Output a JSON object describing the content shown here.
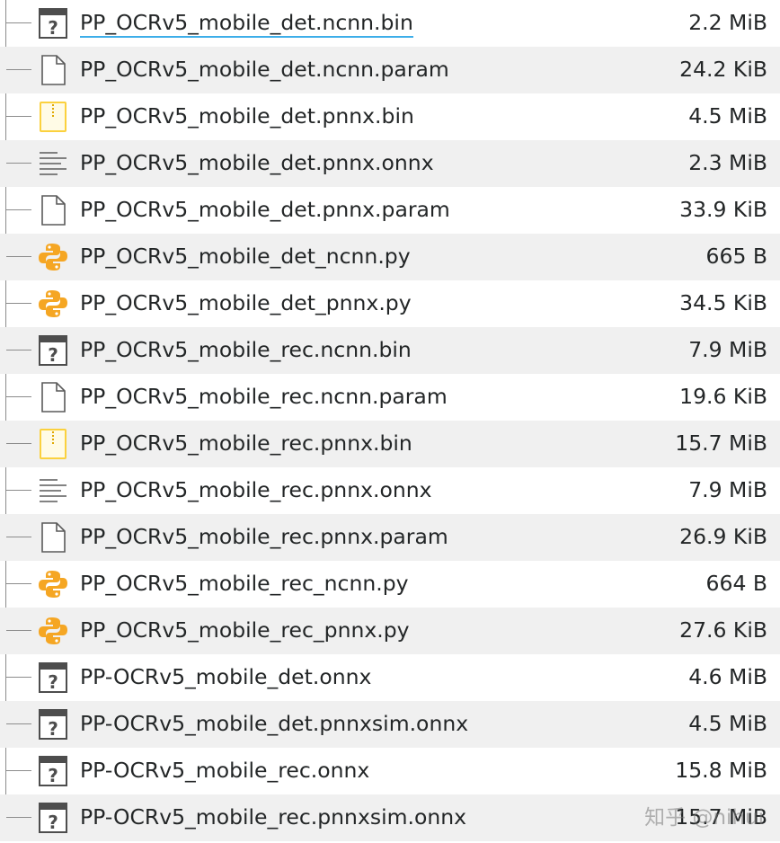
{
  "files": [
    {
      "name": "PP_OCRv5_mobile_det.ncnn.bin",
      "size": "2.2 MiB",
      "icon": "unknown-file-icon",
      "current": true
    },
    {
      "name": "PP_OCRv5_mobile_det.ncnn.param",
      "size": "24.2 KiB",
      "icon": "blank-file-icon"
    },
    {
      "name": "PP_OCRv5_mobile_det.pnnx.bin",
      "size": "4.5 MiB",
      "icon": "archive-file-icon"
    },
    {
      "name": "PP_OCRv5_mobile_det.pnnx.onnx",
      "size": "2.3 MiB",
      "icon": "text-file-icon"
    },
    {
      "name": "PP_OCRv5_mobile_det.pnnx.param",
      "size": "33.9 KiB",
      "icon": "blank-file-icon"
    },
    {
      "name": "PP_OCRv5_mobile_det_ncnn.py",
      "size": "665 B",
      "icon": "python-file-icon"
    },
    {
      "name": "PP_OCRv5_mobile_det_pnnx.py",
      "size": "34.5 KiB",
      "icon": "python-file-icon"
    },
    {
      "name": "PP_OCRv5_mobile_rec.ncnn.bin",
      "size": "7.9 MiB",
      "icon": "unknown-file-icon"
    },
    {
      "name": "PP_OCRv5_mobile_rec.ncnn.param",
      "size": "19.6 KiB",
      "icon": "blank-file-icon"
    },
    {
      "name": "PP_OCRv5_mobile_rec.pnnx.bin",
      "size": "15.7 MiB",
      "icon": "archive-file-icon"
    },
    {
      "name": "PP_OCRv5_mobile_rec.pnnx.onnx",
      "size": "7.9 MiB",
      "icon": "text-file-icon"
    },
    {
      "name": "PP_OCRv5_mobile_rec.pnnx.param",
      "size": "26.9 KiB",
      "icon": "blank-file-icon"
    },
    {
      "name": "PP_OCRv5_mobile_rec_ncnn.py",
      "size": "664 B",
      "icon": "python-file-icon"
    },
    {
      "name": "PP_OCRv5_mobile_rec_pnnx.py",
      "size": "27.6 KiB",
      "icon": "python-file-icon"
    },
    {
      "name": "PP-OCRv5_mobile_det.onnx",
      "size": "4.6 MiB",
      "icon": "unknown-file-icon"
    },
    {
      "name": "PP-OCRv5_mobile_det.pnnxsim.onnx",
      "size": "4.5 MiB",
      "icon": "unknown-file-icon"
    },
    {
      "name": "PP-OCRv5_mobile_rec.onnx",
      "size": "15.8 MiB",
      "icon": "unknown-file-icon"
    },
    {
      "name": "PP-OCRv5_mobile_rec.pnnxsim.onnx",
      "size": "15.7 MiB",
      "icon": "unknown-file-icon"
    }
  ],
  "colors": {
    "alt_row": "#f0f0f0",
    "text": "#232627",
    "focus_underline": "#3daee9",
    "python_icon": "#f5a623",
    "archive_icon": "#fbd13e"
  },
  "watermark": "知乎 @nihui"
}
